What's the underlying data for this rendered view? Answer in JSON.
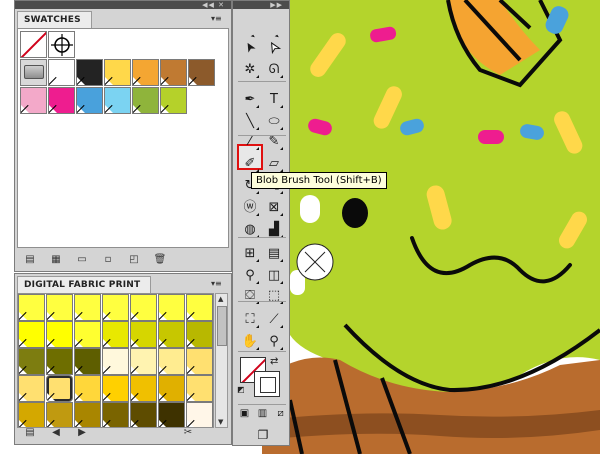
{
  "swatches_panel": {
    "title": "SWATCHES",
    "rows": [
      [
        {
          "type": "none",
          "name": "none-swatch"
        },
        {
          "type": "registration",
          "name": "registration-swatch"
        }
      ],
      [
        {
          "type": "folder",
          "color": "#d9d9d9"
        },
        {
          "type": "color",
          "color": "#ffffff"
        },
        {
          "type": "color",
          "color": "#232323"
        },
        {
          "type": "color",
          "color": "#ffd84a"
        },
        {
          "type": "color",
          "color": "#f4a632"
        },
        {
          "type": "color",
          "color": "#c07a32"
        },
        {
          "type": "color",
          "color": "#8c5a2b"
        }
      ],
      [
        {
          "type": "color",
          "color": "#f3a9c9"
        },
        {
          "type": "color",
          "color": "#ee1d8f"
        },
        {
          "type": "color",
          "color": "#49a1dc"
        },
        {
          "type": "color",
          "color": "#7bd3f2"
        },
        {
          "type": "color",
          "color": "#8fb43b"
        },
        {
          "type": "color",
          "color": "#b5d12a"
        }
      ]
    ],
    "bottom_buttons": [
      "swatch-libraries-menu-icon",
      "show-kinds-icon",
      "swatch-options-icon",
      "new-color-group-icon",
      "new-swatch-icon",
      "delete-swatch-icon"
    ]
  },
  "fabric_panel": {
    "title": "DIGITAL FABRIC PRINT",
    "rows": [
      [
        "#ffff40",
        "#ffff40",
        "#ffff40",
        "#ffff40",
        "#ffff40",
        "#ffff40",
        "#ffff40"
      ],
      [
        "#ffff00",
        "#ffff00",
        "#ffff30",
        "#e8e800",
        "#d6d600",
        "#c7c700",
        "#b8b800"
      ],
      [
        "#7d7d10",
        "#6e6e00",
        "#5e5e00",
        "#fff8dc",
        "#fff3b0",
        "#ffec90",
        "#ffe070"
      ],
      [
        "#ffe070",
        "#ffe070",
        "#ffd73a",
        "#ffd000",
        "#f0c000",
        "#e0b000",
        "#ffe070"
      ],
      [
        "#d4a800",
        "#c09a10",
        "#a98600",
        "#7a6400",
        "#5e4c00",
        "#3e3200",
        "#fff6e8"
      ]
    ],
    "selected": [
      3,
      1
    ],
    "bottom_buttons": [
      "swatch-libraries-menu-icon",
      "previous-library-icon",
      "next-library-icon",
      "delete-icon"
    ]
  },
  "toolbar": {
    "tools": [
      {
        "name": "selection-tool-icon",
        "glyph": "➤",
        "col": 0,
        "row": 0
      },
      {
        "name": "direct-selection-tool-icon",
        "glyph": "➤",
        "col": 1,
        "row": 0
      },
      {
        "name": "magic-wand-tool-icon",
        "glyph": "✲",
        "col": 0,
        "row": 1
      },
      {
        "name": "lasso-tool-icon",
        "glyph": "ᘏ",
        "col": 1,
        "row": 1
      },
      {
        "name": "pen-tool-icon",
        "glyph": "✒",
        "col": 0,
        "row": 2
      },
      {
        "name": "type-tool-icon",
        "glyph": "T",
        "col": 1,
        "row": 2
      },
      {
        "name": "line-segment-tool-icon",
        "glyph": "╲",
        "col": 0,
        "row": 3
      },
      {
        "name": "ellipse-tool-icon",
        "glyph": "⬭",
        "col": 1,
        "row": 3
      },
      {
        "name": "paintbrush-tool-icon",
        "glyph": "⁄",
        "col": 0,
        "row": 4
      },
      {
        "name": "pencil-tool-icon",
        "glyph": "✎",
        "col": 1,
        "row": 4
      },
      {
        "name": "blob-brush-tool-icon",
        "glyph": "✐",
        "col": 0,
        "row": 5
      },
      {
        "name": "eraser-tool-icon",
        "glyph": "▱",
        "col": 1,
        "row": 5
      },
      {
        "name": "rotate-tool-icon",
        "glyph": "↻",
        "col": 0,
        "row": 6
      },
      {
        "name": "scale-tool-icon",
        "glyph": "⤡",
        "col": 1,
        "row": 6
      },
      {
        "name": "warp-tool-icon",
        "glyph": "ⓦ",
        "col": 0,
        "row": 7
      },
      {
        "name": "free-transform-tool-icon",
        "glyph": "⊠",
        "col": 1,
        "row": 7
      },
      {
        "name": "symbol-sprayer-tool-icon",
        "glyph": "◍",
        "col": 0,
        "row": 8
      },
      {
        "name": "column-graph-tool-icon",
        "glyph": "▟",
        "col": 1,
        "row": 8
      },
      {
        "name": "mesh-tool-icon",
        "glyph": "⊞",
        "col": 0,
        "row": 9
      },
      {
        "name": "gradient-tool-icon",
        "glyph": "▤",
        "col": 1,
        "row": 9
      },
      {
        "name": "eyedropper-tool-icon",
        "glyph": "⚲",
        "col": 0,
        "row": 10
      },
      {
        "name": "blend-tool-icon",
        "glyph": "◫",
        "col": 1,
        "row": 10
      },
      {
        "name": "live-paint-bucket-tool-icon",
        "glyph": "⛋",
        "col": 0,
        "row": 11
      },
      {
        "name": "live-paint-selection-tool-icon",
        "glyph": "⬚",
        "col": 1,
        "row": 11
      },
      {
        "name": "artboard-tool-icon",
        "glyph": "⛶",
        "col": 0,
        "row": 12
      },
      {
        "name": "slice-tool-icon",
        "glyph": "⟋",
        "col": 1,
        "row": 12
      },
      {
        "name": "hand-tool-icon",
        "glyph": "✋",
        "col": 0,
        "row": 13
      },
      {
        "name": "zoom-tool-icon",
        "glyph": "⚲",
        "col": 1,
        "row": 13
      }
    ],
    "tooltip": "Blob Brush Tool (Shift+B)"
  },
  "artwork_colors": {
    "background": "#ffffff",
    "frosting": "#b4d42c",
    "outline": "#0a0a0a",
    "cake": "#b96c2e",
    "cake_dark": "#8d4f20",
    "cone": "#f5a431",
    "cone_light": "#ffd84a",
    "sprinkle_yellow": "#ffd84a",
    "sprinkle_pink": "#ee1d8f",
    "sprinkle_blue": "#4aa2dc"
  }
}
